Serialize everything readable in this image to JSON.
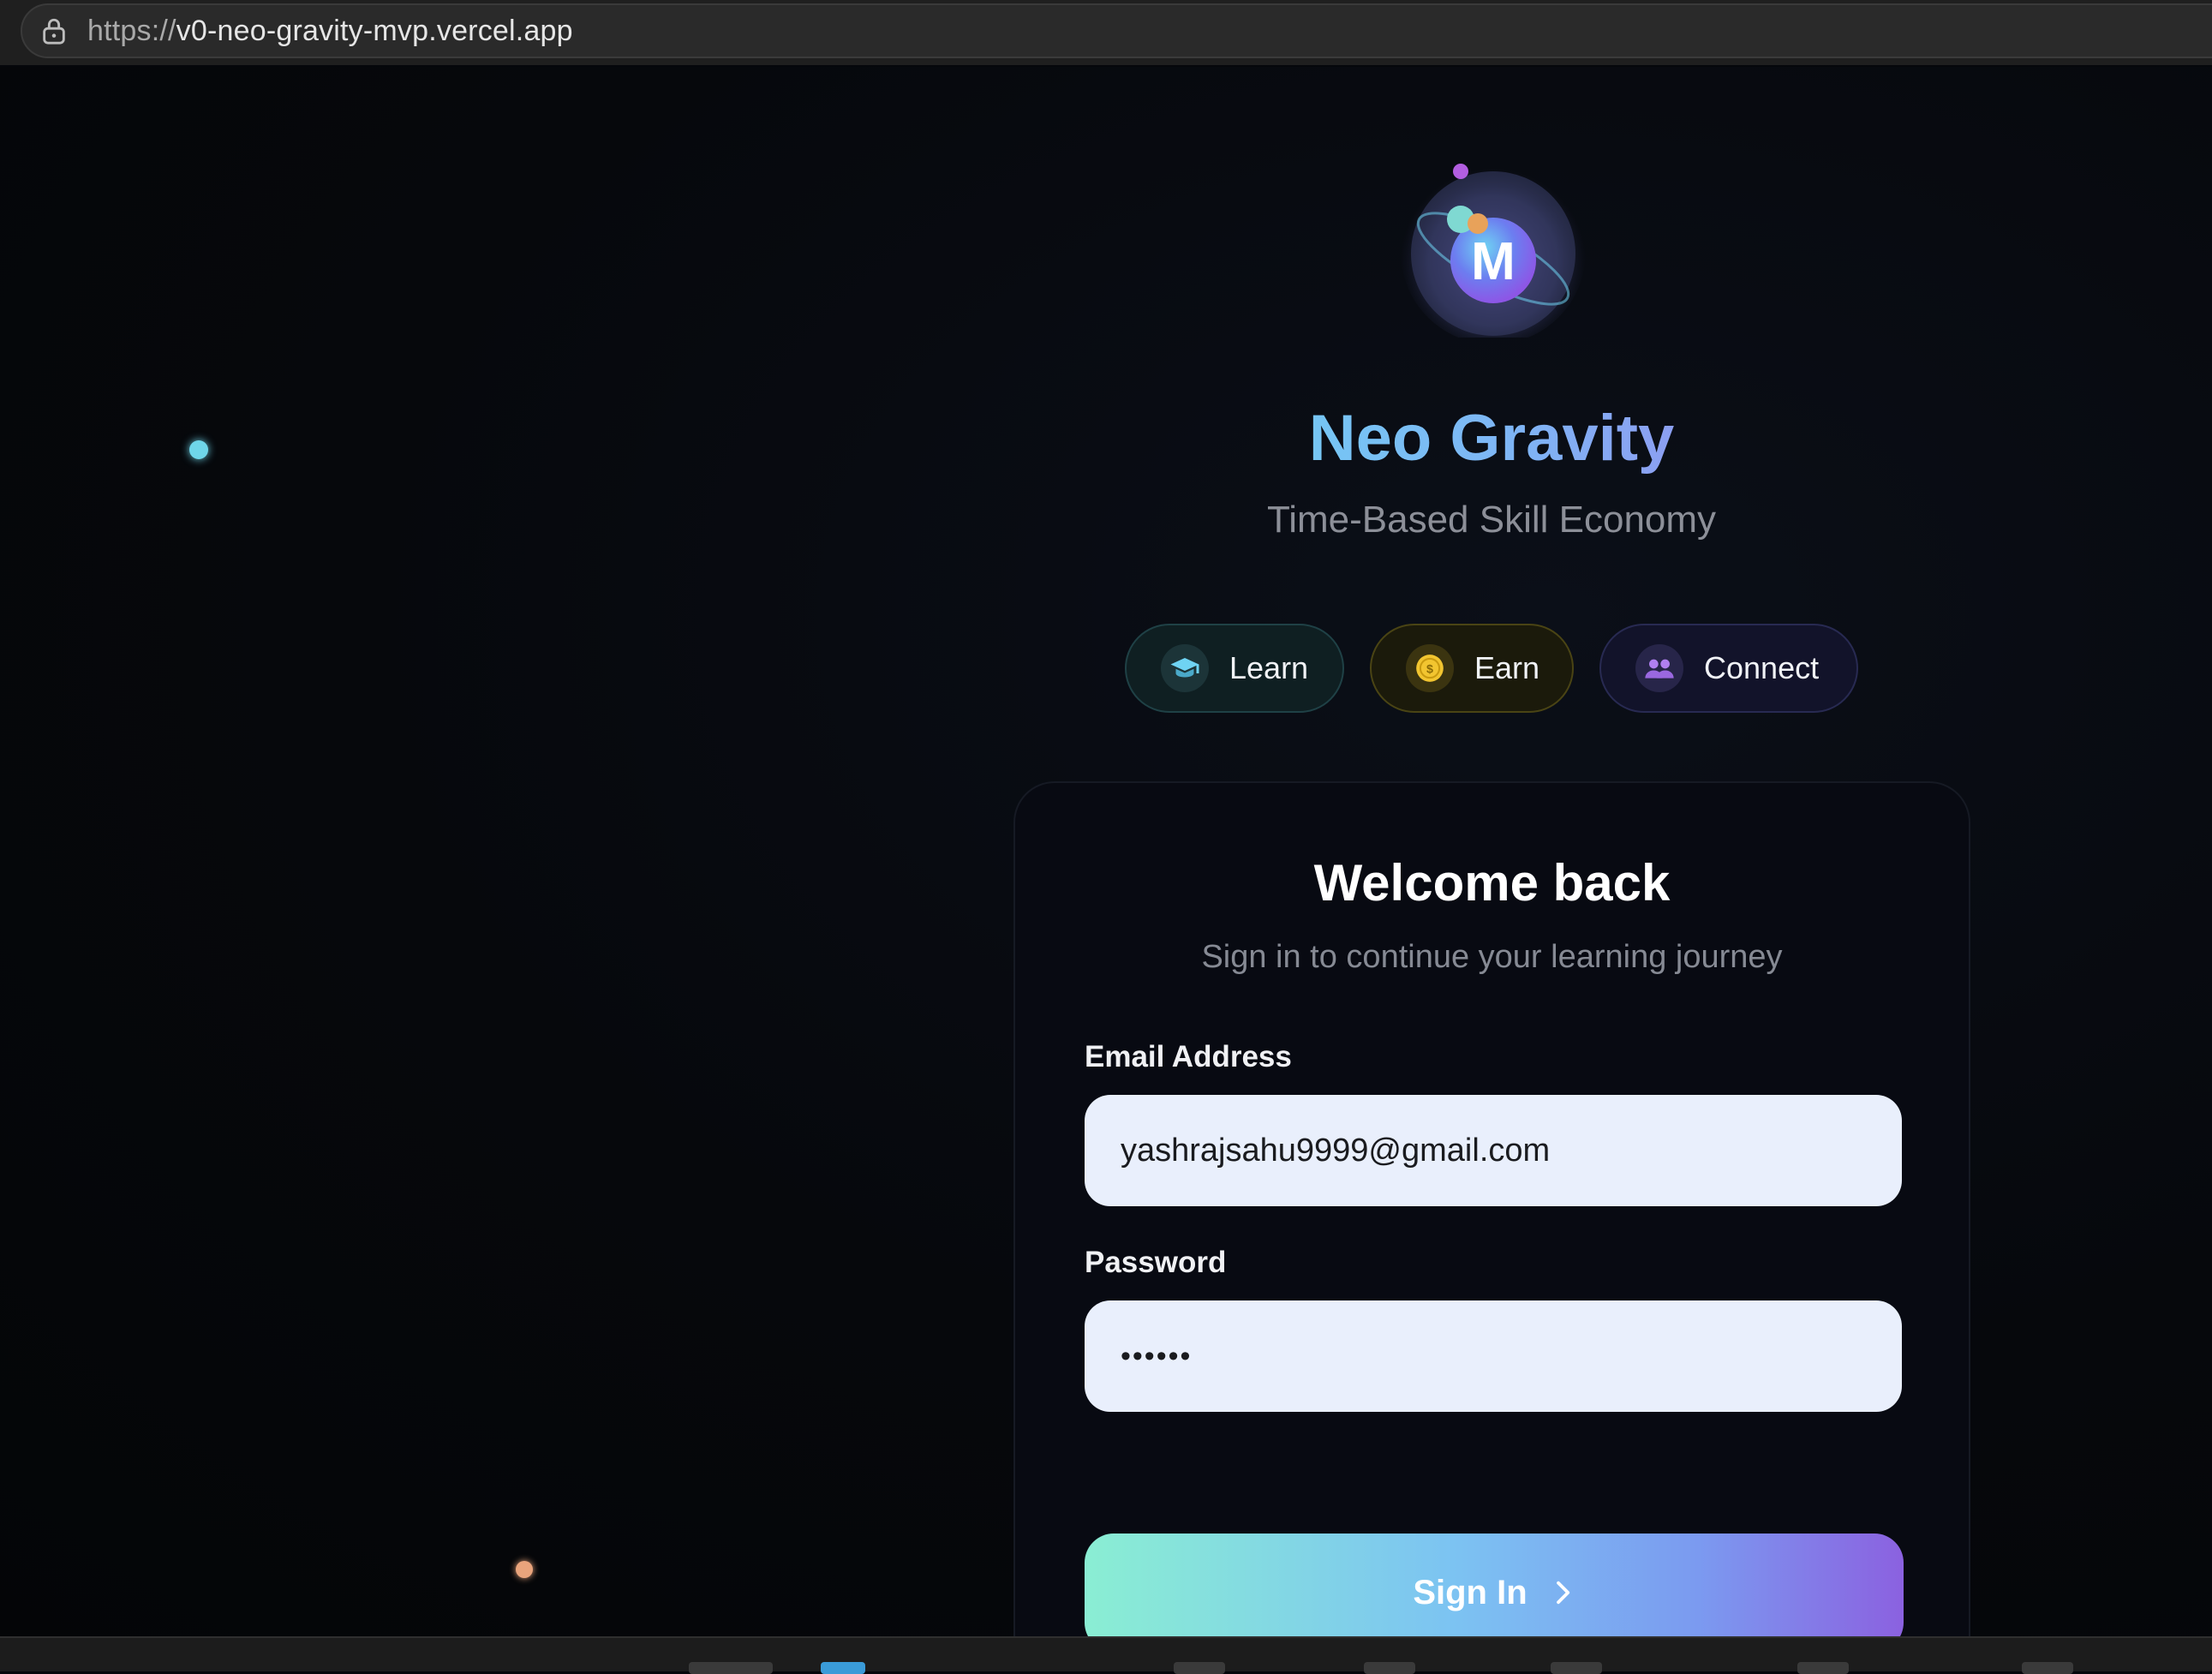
{
  "browser": {
    "url_scheme": "https://",
    "url_host": "v0-neo-gravity-mvp.vercel.app"
  },
  "logo": {
    "letter": "M"
  },
  "brand": {
    "title": "Neo Gravity",
    "subtitle": "Time-Based Skill Economy"
  },
  "features": [
    {
      "label": "Learn",
      "icon": "graduation-cap-icon",
      "color": "#6fd3f3"
    },
    {
      "label": "Earn",
      "icon": "coin-icon",
      "color": "#f2c530"
    },
    {
      "label": "Connect",
      "icon": "users-icon",
      "color": "#a978e8"
    }
  ],
  "login": {
    "title": "Welcome back",
    "subtitle": "Sign in to continue your learning journey",
    "email_label": "Email Address",
    "email_value": "yashrajsahu9999@gmail.com",
    "password_label": "Password",
    "password_value": "••••••",
    "submit_label": "Sign In"
  },
  "colors": {
    "background": "#05070b",
    "accent_start": "#8aeed3",
    "accent_end": "#8b61e0",
    "input_bg": "#e9effc"
  }
}
